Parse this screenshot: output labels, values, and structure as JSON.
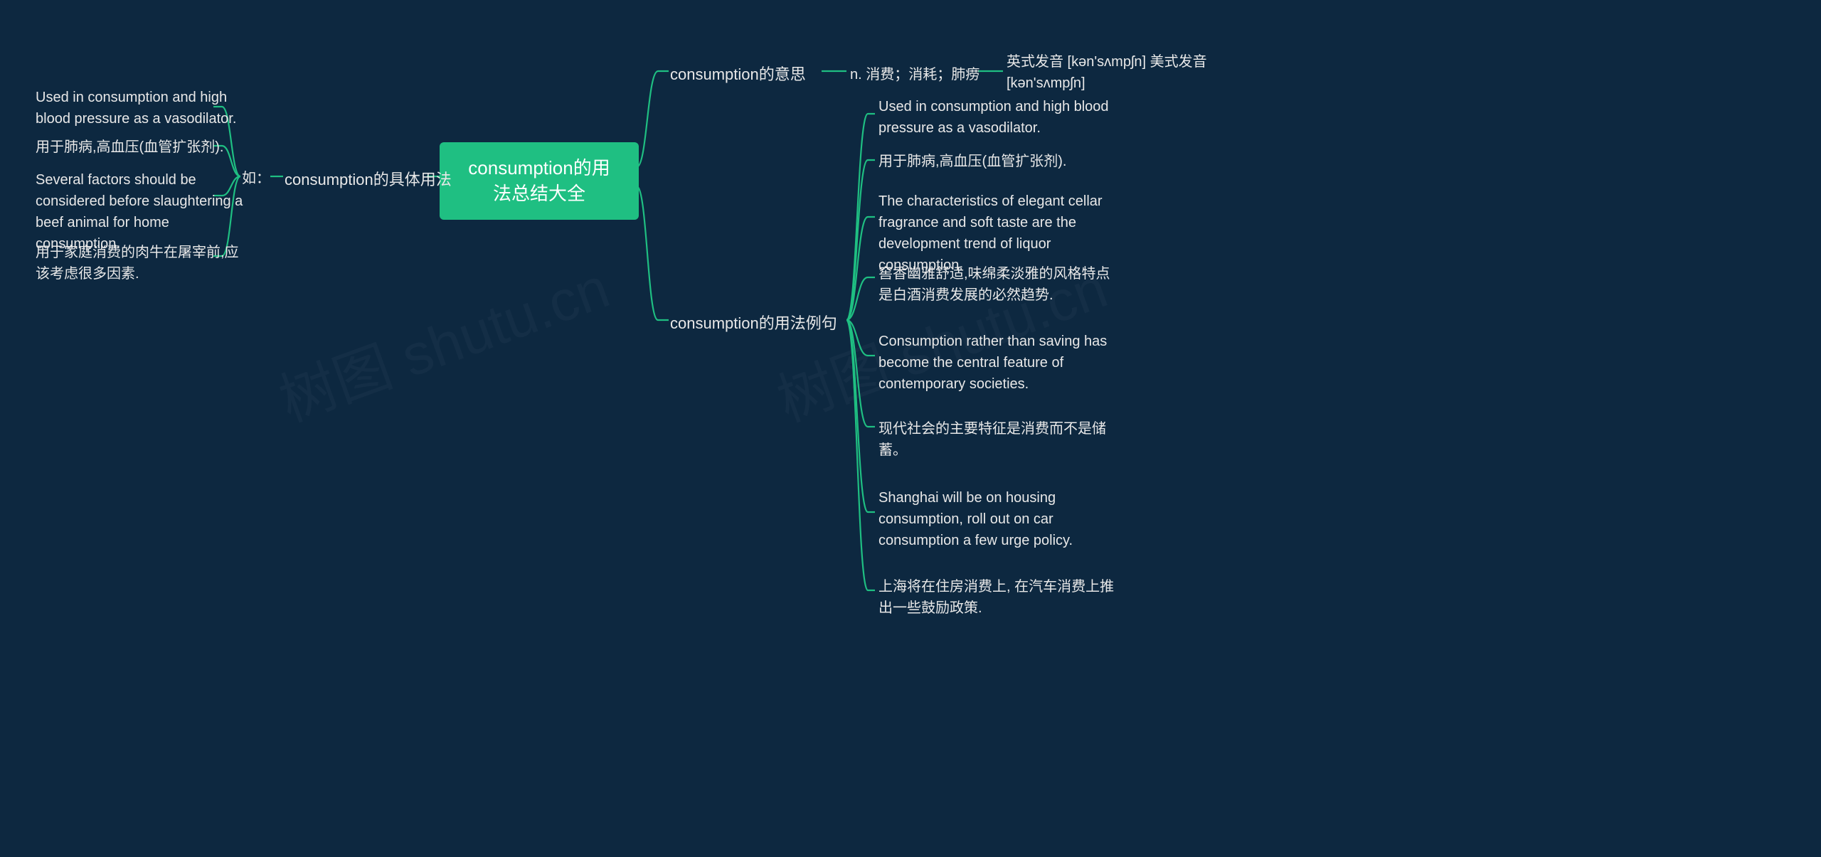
{
  "center": "consumption的用法总结大全",
  "watermark": "树图 shutu.cn",
  "left": {
    "branch": "consumption的具体用法",
    "sub": "如：",
    "items": [
      "Used in consumption and high blood pressure as a vasodilator.",
      "用于肺病,高血压(血管扩张剂).",
      "Several factors should be considered before slaughtering a beef animal for home consumption.",
      "用于家庭消费的肉牛在屠宰前,应该考虑很多因素."
    ]
  },
  "right": {
    "branch1": {
      "label": "consumption的意思",
      "sub": "n. 消费；消耗；肺痨",
      "leaf": "英式发音 [kən'sʌmpʃn] 美式发音 [kən'sʌmpʃn]"
    },
    "branch2": {
      "label": "consumption的用法例句",
      "items": [
        "Used in consumption and high blood pressure as a vasodilator.",
        "用于肺病,高血压(血管扩张剂).",
        "The characteristics of elegant cellar fragrance and soft taste are the development trend of liquor consumption.",
        "窖香幽雅舒适,味绵柔淡雅的风格特点是白酒消费发展的必然趋势.",
        "Consumption rather than saving has become the central feature of contemporary societies.",
        "现代社会的主要特征是消费而不是储蓄。",
        "Shanghai will be on housing consumption, roll out on car consumption a few urge policy.",
        "上海将在住房消费上, 在汽车消费上推出一些鼓励政策."
      ]
    }
  }
}
